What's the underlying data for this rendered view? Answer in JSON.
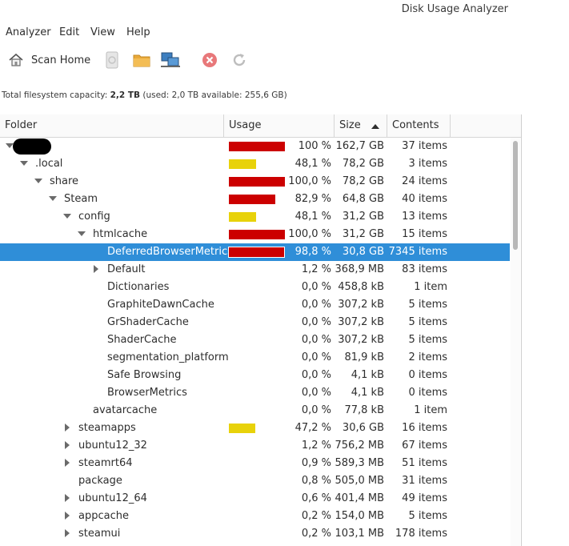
{
  "window": {
    "title": "Disk Usage Analyzer"
  },
  "menu": {
    "items": [
      "Analyzer",
      "Edit",
      "View",
      "Help"
    ]
  },
  "toolbar": {
    "scan_home_label": "Scan Home"
  },
  "capacity": {
    "prefix": "Total filesystem capacity:",
    "total": "2,2 TB",
    "detail": "(used: 2,0 TB available: 255,6 GB)"
  },
  "columns": {
    "folder": "Folder",
    "usage": "Usage",
    "size": "Size",
    "contents": "Contents"
  },
  "colors": {
    "selection": "#2f8ed8",
    "bar_high": "#cc0000",
    "bar_mid": "#e8d20a"
  },
  "rows": [
    {
      "name": "",
      "depth": 0,
      "expander": "open",
      "redacted": true,
      "usage_pct": 100,
      "bar_color": "red",
      "percent": "100 %",
      "size": "162,7 GB",
      "contents": "37 items"
    },
    {
      "name": ".local",
      "depth": 1,
      "expander": "open",
      "usage_pct": 48.1,
      "bar_color": "yellow",
      "percent": "48,1 %",
      "size": "78,2 GB",
      "contents": "3 items"
    },
    {
      "name": "share",
      "depth": 2,
      "expander": "open",
      "usage_pct": 100,
      "bar_color": "red",
      "percent": "100,0 %",
      "size": "78,2 GB",
      "contents": "24 items"
    },
    {
      "name": "Steam",
      "depth": 3,
      "expander": "open",
      "usage_pct": 82.9,
      "bar_color": "red",
      "percent": "82,9 %",
      "size": "64,8 GB",
      "contents": "40 items"
    },
    {
      "name": "config",
      "depth": 4,
      "expander": "open",
      "usage_pct": 48.1,
      "bar_color": "yellow",
      "percent": "48,1 %",
      "size": "31,2 GB",
      "contents": "13 items"
    },
    {
      "name": "htmlcache",
      "depth": 5,
      "expander": "open",
      "usage_pct": 100,
      "bar_color": "red",
      "percent": "100,0 %",
      "size": "31,2 GB",
      "contents": "15 items"
    },
    {
      "name": "DeferredBrowserMetrics",
      "depth": 6,
      "expander": "none",
      "selected": true,
      "usage_pct": 98.8,
      "bar_color": "red",
      "percent": "98,8 %",
      "size": "30,8 GB",
      "contents": "7345 items"
    },
    {
      "name": "Default",
      "depth": 6,
      "expander": "closed",
      "usage_pct": 1.2,
      "bar_color": "none",
      "percent": "1,2 %",
      "size": "368,9 MB",
      "contents": "83 items"
    },
    {
      "name": "Dictionaries",
      "depth": 6,
      "expander": "none",
      "usage_pct": 0,
      "bar_color": "none",
      "percent": "0,0 %",
      "size": "458,8 kB",
      "contents": "1 item"
    },
    {
      "name": "GraphiteDawnCache",
      "depth": 6,
      "expander": "none",
      "usage_pct": 0,
      "bar_color": "none",
      "percent": "0,0 %",
      "size": "307,2 kB",
      "contents": "5 items"
    },
    {
      "name": "GrShaderCache",
      "depth": 6,
      "expander": "none",
      "usage_pct": 0,
      "bar_color": "none",
      "percent": "0,0 %",
      "size": "307,2 kB",
      "contents": "5 items"
    },
    {
      "name": "ShaderCache",
      "depth": 6,
      "expander": "none",
      "usage_pct": 0,
      "bar_color": "none",
      "percent": "0,0 %",
      "size": "307,2 kB",
      "contents": "5 items"
    },
    {
      "name": "segmentation_platform",
      "depth": 6,
      "expander": "none",
      "usage_pct": 0,
      "bar_color": "none",
      "percent": "0,0 %",
      "size": "81,9 kB",
      "contents": "2 items"
    },
    {
      "name": "Safe Browsing",
      "depth": 6,
      "expander": "none",
      "usage_pct": 0,
      "bar_color": "none",
      "percent": "0,0 %",
      "size": "4,1 kB",
      "contents": "0 items"
    },
    {
      "name": "BrowserMetrics",
      "depth": 6,
      "expander": "none",
      "usage_pct": 0,
      "bar_color": "none",
      "percent": "0,0 %",
      "size": "4,1 kB",
      "contents": "0 items"
    },
    {
      "name": "avatarcache",
      "depth": 5,
      "expander": "none",
      "usage_pct": 0,
      "bar_color": "none",
      "percent": "0,0 %",
      "size": "77,8 kB",
      "contents": "1 item"
    },
    {
      "name": "steamapps",
      "depth": 4,
      "expander": "closed",
      "usage_pct": 47.2,
      "bar_color": "yellow",
      "percent": "47,2 %",
      "size": "30,6 GB",
      "contents": "16 items"
    },
    {
      "name": "ubuntu12_32",
      "depth": 4,
      "expander": "closed",
      "usage_pct": 1.2,
      "bar_color": "none",
      "percent": "1,2 %",
      "size": "756,2 MB",
      "contents": "67 items"
    },
    {
      "name": "steamrt64",
      "depth": 4,
      "expander": "closed",
      "usage_pct": 0.9,
      "bar_color": "none",
      "percent": "0,9 %",
      "size": "589,3 MB",
      "contents": "51 items"
    },
    {
      "name": "package",
      "depth": 4,
      "expander": "none",
      "usage_pct": 0.8,
      "bar_color": "none",
      "percent": "0,8 %",
      "size": "505,0 MB",
      "contents": "31 items"
    },
    {
      "name": "ubuntu12_64",
      "depth": 4,
      "expander": "closed",
      "usage_pct": 0.6,
      "bar_color": "none",
      "percent": "0,6 %",
      "size": "401,4 MB",
      "contents": "49 items"
    },
    {
      "name": "appcache",
      "depth": 4,
      "expander": "closed",
      "usage_pct": 0.2,
      "bar_color": "none",
      "percent": "0,2 %",
      "size": "154,0 MB",
      "contents": "5 items"
    },
    {
      "name": "steamui",
      "depth": 4,
      "expander": "closed",
      "usage_pct": 0.2,
      "bar_color": "none",
      "percent": "0,2 %",
      "size": "103,1 MB",
      "contents": "178 items"
    }
  ]
}
